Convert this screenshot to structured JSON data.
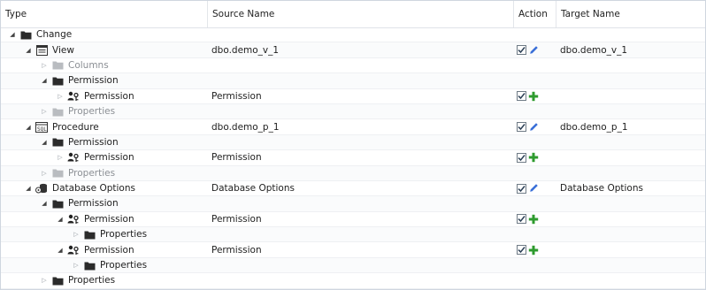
{
  "columns": {
    "type": "Type",
    "source": "Source Name",
    "action": "Action",
    "target": "Target Name"
  },
  "rows": [
    {
      "depth": 0,
      "expanded": true,
      "icon": "folder-icon",
      "muted": false,
      "type": "Change",
      "source": "",
      "action": "",
      "target": ""
    },
    {
      "depth": 1,
      "expanded": true,
      "icon": "view-icon",
      "muted": false,
      "type": "View",
      "source": "dbo.demo_v_1",
      "action": "alter-icon",
      "target": "dbo.demo_v_1"
    },
    {
      "depth": 2,
      "expanded": false,
      "icon": "folder-icon",
      "muted": true,
      "type": "Columns",
      "source": "",
      "action": "",
      "target": ""
    },
    {
      "depth": 2,
      "expanded": true,
      "icon": "folder-icon",
      "muted": false,
      "type": "Permission",
      "source": "",
      "action": "",
      "target": ""
    },
    {
      "depth": 3,
      "expanded": false,
      "icon": "permission-icon",
      "muted": false,
      "type": "Permission",
      "source": "Permission",
      "action": "add-icon",
      "target": ""
    },
    {
      "depth": 2,
      "expanded": false,
      "icon": "folder-icon",
      "muted": true,
      "type": "Properties",
      "source": "",
      "action": "",
      "target": ""
    },
    {
      "depth": 1,
      "expanded": true,
      "icon": "procedure-icon",
      "muted": false,
      "type": "Procedure",
      "source": "dbo.demo_p_1",
      "action": "alter-icon",
      "target": "dbo.demo_p_1"
    },
    {
      "depth": 2,
      "expanded": true,
      "icon": "folder-icon",
      "muted": false,
      "type": "Permission",
      "source": "",
      "action": "",
      "target": ""
    },
    {
      "depth": 3,
      "expanded": false,
      "icon": "permission-icon",
      "muted": false,
      "type": "Permission",
      "source": "Permission",
      "action": "add-icon",
      "target": ""
    },
    {
      "depth": 2,
      "expanded": false,
      "icon": "folder-icon",
      "muted": true,
      "type": "Properties",
      "source": "",
      "action": "",
      "target": ""
    },
    {
      "depth": 1,
      "expanded": true,
      "icon": "database-icon",
      "muted": false,
      "type": "Database Options",
      "source": "Database Options",
      "action": "alter-icon",
      "target": "Database Options"
    },
    {
      "depth": 2,
      "expanded": true,
      "icon": "folder-icon",
      "muted": false,
      "type": "Permission",
      "source": "",
      "action": "",
      "target": ""
    },
    {
      "depth": 3,
      "expanded": true,
      "icon": "permission-icon",
      "muted": false,
      "type": "Permission",
      "source": "Permission",
      "action": "add-icon",
      "target": ""
    },
    {
      "depth": 4,
      "expanded": false,
      "icon": "folder-icon",
      "muted": false,
      "type": "Properties",
      "source": "",
      "action": "",
      "target": ""
    },
    {
      "depth": 3,
      "expanded": true,
      "icon": "permission-icon",
      "muted": false,
      "type": "Permission",
      "source": "Permission",
      "action": "add-icon",
      "target": ""
    },
    {
      "depth": 4,
      "expanded": false,
      "icon": "folder-icon",
      "muted": false,
      "type": "Properties",
      "source": "",
      "action": "",
      "target": ""
    },
    {
      "depth": 2,
      "expanded": false,
      "icon": "folder-icon",
      "muted": false,
      "type": "Properties",
      "source": "",
      "action": "",
      "target": ""
    }
  ],
  "colors": {
    "alter": "#3a6fd8",
    "add": "#2e9b2e",
    "folder": "#2b2b2b",
    "folder_muted": "#b9bcc0"
  }
}
